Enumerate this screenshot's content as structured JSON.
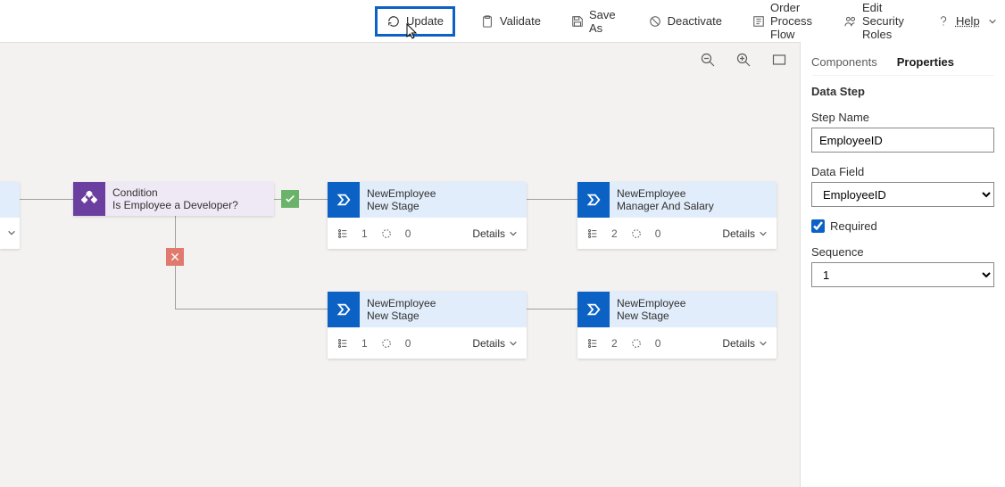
{
  "toolbar": {
    "update": "Update",
    "validate": "Validate",
    "saveAs": "Save As",
    "deactivate": "Deactivate",
    "orderProcessFlow": "Order Process Flow",
    "editSecurityRoles": "Edit Security Roles",
    "help": "Help"
  },
  "canvas": {
    "partial": {
      "detailsChevron": "⌄"
    },
    "condition": {
      "title": "Condition",
      "subtitle": "Is Employee a Developer?"
    },
    "stages": [
      {
        "entity": "NewEmployee",
        "name": "New Stage",
        "steps": "1",
        "loops": "0",
        "details": "Details"
      },
      {
        "entity": "NewEmployee",
        "name": "Manager And Salary",
        "steps": "2",
        "loops": "0",
        "details": "Details"
      },
      {
        "entity": "NewEmployee",
        "name": "New Stage",
        "steps": "1",
        "loops": "0",
        "details": "Details"
      },
      {
        "entity": "NewEmployee",
        "name": "New Stage",
        "steps": "2",
        "loops": "0",
        "details": "Details"
      }
    ]
  },
  "panel": {
    "tabs": {
      "components": "Components",
      "properties": "Properties"
    },
    "heading": "Data Step",
    "stepNameLabel": "Step Name",
    "stepNameValue": "EmployeeID",
    "dataFieldLabel": "Data Field",
    "dataFieldValue": "EmployeeID",
    "requiredLabel": "Required",
    "sequenceLabel": "Sequence",
    "sequenceValue": "1"
  }
}
